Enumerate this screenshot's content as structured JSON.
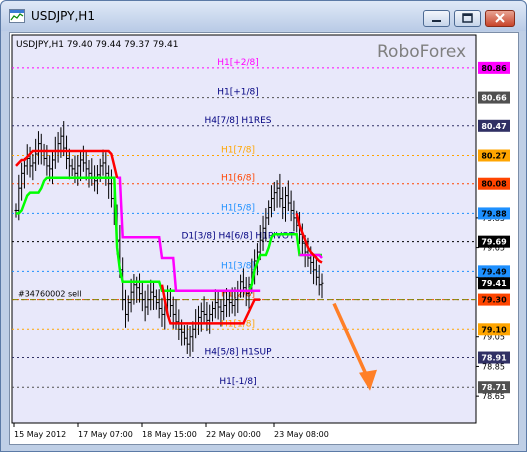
{
  "window": {
    "title": "USDJPY,H1"
  },
  "colors": {
    "plot_bg": "#e8e8fa",
    "axis_bg": "#ffffff",
    "candle": "#000000",
    "green_line": "#00ff00",
    "magenta_line": "#ff00ff",
    "red_line": "#ff0000",
    "arrow": "#ff7f27",
    "watermark": "#7f7f7f"
  },
  "chart_data": {
    "type": "line",
    "symbol_label": "USDJPY,H1  79.40 79.44 79.37 79.41",
    "watermark": "RoboForex",
    "ylim": [
      78.55,
      80.96
    ],
    "x_labels": [
      "15 May 2012",
      "17 May 07:00",
      "18 May 15:00",
      "22 May 00:00",
      "23 May 08:00"
    ],
    "y_ticks": [
      "79.85",
      "79.65",
      "79.45",
      "79.05",
      "78.85",
      "78.65"
    ],
    "price_tags": [
      {
        "text": "80.86",
        "value": 80.86,
        "color": "#ff00ff",
        "text_color": "#000000"
      },
      {
        "text": "80.66",
        "value": 80.66,
        "color": "#505050",
        "text_color": "#ffffff"
      },
      {
        "text": "80.47",
        "value": 80.47,
        "color": "#303064",
        "text_color": "#ffffff"
      },
      {
        "text": "80.27",
        "value": 80.27,
        "color": "#ffa500",
        "text_color": "#000000"
      },
      {
        "text": "80.08",
        "value": 80.08,
        "color": "#ff4500",
        "text_color": "#000000"
      },
      {
        "text": "79.88",
        "value": 79.88,
        "color": "#1e90ff",
        "text_color": "#000000"
      },
      {
        "text": "79.69",
        "value": 79.69,
        "color": "#000000",
        "text_color": "#ffffff"
      },
      {
        "text": "79.49",
        "value": 79.49,
        "color": "#1e90ff",
        "text_color": "#000000"
      },
      {
        "text": "79.41",
        "value": 79.41,
        "color": "#000000",
        "text_color": "#ffffff"
      },
      {
        "text": "79.30",
        "value": 79.3,
        "color": "#ff4500",
        "text_color": "#000000"
      },
      {
        "text": "79.10",
        "value": 79.1,
        "color": "#ffa500",
        "text_color": "#000000"
      },
      {
        "text": "78.91",
        "value": 78.91,
        "color": "#303064",
        "text_color": "#ffffff"
      },
      {
        "text": "78.71",
        "value": 78.71,
        "color": "#505050",
        "text_color": "#ffffff"
      }
    ],
    "levels": [
      {
        "label": "H1[+2/8]",
        "value": 80.86,
        "color": "#ff00ff",
        "label_color": "#ff00ff"
      },
      {
        "label": "H1[+1/8]",
        "value": 80.66,
        "color": "#505050",
        "label_color": "#000080"
      },
      {
        "label": "H4[7/8] H1RES",
        "value": 80.47,
        "color": "#303064",
        "label_color": "#000080"
      },
      {
        "label": "H1[7/8]",
        "value": 80.27,
        "color": "#ffa500",
        "label_color": "#ffa500"
      },
      {
        "label": "H1[6/8]",
        "value": 80.08,
        "color": "#ff4500",
        "label_color": "#ff4500"
      },
      {
        "label": "H1[5/8]",
        "value": 79.88,
        "color": "#1e90ff",
        "label_color": "#1e90ff"
      },
      {
        "label": "D1[3/8] H4[6/8] H1PIVOT",
        "value": 79.69,
        "color": "#000000",
        "label_color": "#000080"
      },
      {
        "label": "H1[3/8]",
        "value": 79.49,
        "color": "#1e90ff",
        "label_color": "#1e90ff"
      },
      {
        "label": "H1[2/8]",
        "value": 79.3,
        "color": "#ff4500",
        "label_color": "#ff4500"
      },
      {
        "label": "H1[1/8]",
        "value": 79.1,
        "color": "#ffa500",
        "label_color": "#ffa500"
      },
      {
        "label": "H4[5/8] H1SUP",
        "value": 78.91,
        "color": "#303064",
        "label_color": "#000080"
      },
      {
        "label": "H1[-1/8]",
        "value": 78.71,
        "color": "#505050",
        "label_color": "#000080"
      }
    ],
    "order_line": {
      "label": "#34760002 sell",
      "value": 79.3,
      "color": "#808000"
    },
    "candle_count": 110,
    "candles_close": [
      79.9,
      80.05,
      80.15,
      80.2,
      80.25,
      80.2,
      80.22,
      80.28,
      80.35,
      80.3,
      80.25,
      80.2,
      80.18,
      80.24,
      80.3,
      80.35,
      80.4,
      80.32,
      80.25,
      80.2,
      80.18,
      80.15,
      80.2,
      80.24,
      80.22,
      80.18,
      80.15,
      80.12,
      80.1,
      80.14,
      80.2,
      80.22,
      80.15,
      80.08,
      79.98,
      79.88,
      79.7,
      79.5,
      79.3,
      79.2,
      79.28,
      79.35,
      79.4,
      79.38,
      79.34,
      79.3,
      79.25,
      79.3,
      79.35,
      79.32,
      79.28,
      79.24,
      79.2,
      79.26,
      79.3,
      79.26,
      79.2,
      79.15,
      79.1,
      79.08,
      79.04,
      79.0,
      79.05,
      79.1,
      79.14,
      79.18,
      79.22,
      79.2,
      79.16,
      79.2,
      79.24,
      79.28,
      79.25,
      79.22,
      79.26,
      79.3,
      79.28,
      79.26,
      79.3,
      79.36,
      79.42,
      79.38,
      79.34,
      79.4,
      79.48,
      79.56,
      79.62,
      79.7,
      79.78,
      79.85,
      79.92,
      79.98,
      80.02,
      80.05,
      79.98,
      79.92,
      80.0,
      79.95,
      79.9,
      79.85,
      79.8,
      79.74,
      79.68,
      79.62,
      79.58,
      79.55,
      79.5,
      79.45,
      79.4,
      79.41
    ],
    "candles_range": 0.12,
    "series": [
      {
        "name": "",
        "color": "#00ff00",
        "values": [
          79.88,
          79.88,
          79.9,
          79.95,
          80.0,
          80.02,
          80.02,
          80.02,
          80.02,
          80.05,
          80.1,
          80.12,
          80.12,
          80.12,
          80.12,
          80.12,
          80.12,
          80.12,
          80.12,
          80.12,
          80.12,
          80.12,
          80.12,
          80.12,
          80.12,
          80.12,
          80.12,
          80.12,
          80.12,
          80.12,
          80.12,
          80.12,
          80.12,
          80.12,
          80.12,
          80.12,
          79.65,
          79.5,
          79.42,
          79.42,
          79.42,
          79.42,
          79.42,
          79.42,
          79.42,
          79.42,
          79.42,
          79.42,
          79.42,
          79.42,
          79.42,
          79.42,
          79.36,
          79.36,
          79.36,
          79.36,
          79.36,
          79.36,
          79.36,
          79.36,
          79.36,
          79.36,
          79.36,
          79.36,
          79.36,
          79.36,
          79.36,
          79.36,
          79.36,
          79.36,
          79.36,
          79.36,
          79.36,
          79.36,
          79.36,
          79.36,
          79.36,
          79.36,
          79.36,
          79.36,
          79.36,
          79.36,
          79.36,
          79.36,
          79.4,
          79.5,
          79.55,
          79.6,
          79.6,
          79.6,
          79.65,
          79.72,
          79.74,
          79.74,
          79.74,
          79.74,
          79.74,
          79.74,
          79.74,
          79.74,
          79.74,
          79.6,
          79.6,
          79.6,
          79.6,
          79.6,
          79.6,
          79.6,
          79.6,
          79.6
        ]
      },
      {
        "name": "",
        "color": "#ff00ff",
        "values": [
          null,
          null,
          null,
          null,
          null,
          null,
          null,
          null,
          null,
          null,
          null,
          null,
          null,
          null,
          null,
          null,
          null,
          null,
          null,
          null,
          null,
          null,
          null,
          null,
          null,
          null,
          null,
          null,
          null,
          null,
          null,
          null,
          null,
          null,
          null,
          null,
          80.12,
          80.12,
          79.72,
          79.72,
          79.72,
          79.72,
          79.72,
          79.72,
          79.72,
          79.72,
          79.72,
          79.72,
          79.72,
          79.72,
          79.72,
          79.72,
          79.58,
          79.58,
          79.58,
          79.58,
          79.58,
          79.36,
          79.36,
          79.36,
          79.36,
          79.36,
          79.36,
          79.36,
          79.36,
          79.36,
          79.36,
          79.36,
          79.36,
          79.36,
          79.36,
          79.36,
          79.36,
          79.36,
          79.36,
          79.36,
          79.36,
          79.36,
          79.36,
          79.36,
          79.36,
          79.36,
          79.36,
          79.36,
          79.36,
          79.36,
          79.36,
          79.36,
          null,
          null,
          null,
          null,
          null,
          null,
          null,
          null,
          null,
          null,
          null,
          null,
          null,
          79.6,
          79.6,
          79.6,
          79.6,
          79.6,
          79.6,
          79.6,
          79.6,
          79.58
        ]
      },
      {
        "name": "",
        "color": "#ff0000",
        "values": [
          80.2,
          80.22,
          80.24,
          80.24,
          80.26,
          80.28,
          80.3,
          80.3,
          80.3,
          80.3,
          80.3,
          80.3,
          80.3,
          80.3,
          80.3,
          80.3,
          80.3,
          80.3,
          80.3,
          80.3,
          80.3,
          80.3,
          80.3,
          80.3,
          80.3,
          80.3,
          80.3,
          80.3,
          80.3,
          80.3,
          80.3,
          80.3,
          80.3,
          80.3,
          80.28,
          80.2,
          80.12,
          null,
          null,
          null,
          null,
          null,
          null,
          null,
          null,
          null,
          null,
          null,
          null,
          null,
          null,
          null,
          79.4,
          79.3,
          79.2,
          79.14,
          79.14,
          79.14,
          79.14,
          79.14,
          79.14,
          79.14,
          79.14,
          79.14,
          79.14,
          79.14,
          79.14,
          79.14,
          79.14,
          79.14,
          79.14,
          79.14,
          79.14,
          79.14,
          79.14,
          79.14,
          79.14,
          79.14,
          79.14,
          79.14,
          79.14,
          79.14,
          79.18,
          79.22,
          79.26,
          79.3,
          79.3,
          79.3,
          null,
          null,
          null,
          null,
          null,
          null,
          null,
          null,
          null,
          null,
          null,
          null,
          79.88,
          79.8,
          79.75,
          79.7,
          79.65,
          79.62,
          79.6,
          79.58,
          79.56,
          79.55
        ]
      }
    ],
    "forecast_arrow": {
      "from_value": 79.3,
      "to_value": 78.7
    }
  }
}
